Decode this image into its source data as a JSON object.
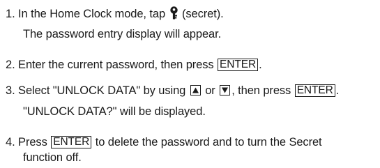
{
  "steps": [
    {
      "number": "1.",
      "before_icon": "In the Home Clock mode, tap ",
      "icon": "key-icon",
      "after_icon": " (secret).",
      "continuation": "The password entry display will appear."
    },
    {
      "number": "2.",
      "text_before_key": "Enter the current password, then press ",
      "key": "ENTER",
      "text_after_key": "."
    },
    {
      "number": "3.",
      "text_start": "Select \"UNLOCK DATA\" by using ",
      "up_key_icon": "up-triangle-key-icon",
      "or_text": " or ",
      "down_key_icon": "down-triangle-key-icon",
      "text_before_key": ", then press ",
      "key": "ENTER",
      "text_after_key": ".",
      "continuation": "\"UNLOCK DATA?\" will be displayed."
    },
    {
      "number": "4.",
      "text_before_key": "Press ",
      "key": "ENTER",
      "text_after_key": " to delete the password and to turn the Secret",
      "continuation": "function off."
    }
  ]
}
